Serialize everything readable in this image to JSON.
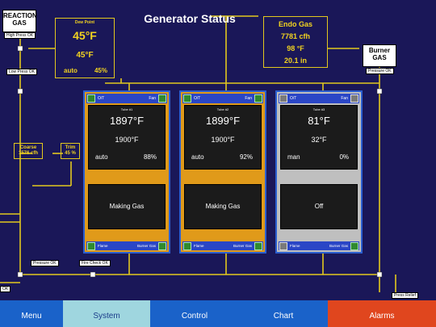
{
  "title": "Generator Status",
  "reaction_gas": {
    "label_line1": "REACTION",
    "label_line2": "GAS",
    "high_press_tag": "High Press OK",
    "low_press_tag": "Low Press OK"
  },
  "burner_gas": {
    "label_line1": "Burner",
    "label_line2": "GAS",
    "pressure_tag": "Pressure OK"
  },
  "dew_point": {
    "label": "Dew Point",
    "value": "45°F",
    "setpoint": "45°F",
    "mode": "auto",
    "output": "45%"
  },
  "endo_gas": {
    "label": "Endo Gas",
    "flow": "7781 cfh",
    "temp": "98 °F",
    "pressure": "20.1 in"
  },
  "coarse": {
    "label": "Coarse",
    "value": "1576 cfh"
  },
  "trim": {
    "label": "Trim",
    "value": "45 %"
  },
  "bottom_tags": {
    "pressure_ok": "Pressure OK",
    "fire_check_ok": "Fire Check OK",
    "press_relief": "Press Relief",
    "left_ok": "OK"
  },
  "tubes": [
    {
      "ot": "O/T",
      "fan": "Fan",
      "name": "Tube #1",
      "temp": "1897°F",
      "setpoint": "1900°F",
      "mode": "auto",
      "output": "88%",
      "status": "Making Gas",
      "flame": "Flame",
      "burner": "Burner Gas"
    },
    {
      "ot": "O/T",
      "fan": "Fan",
      "name": "Tube #2",
      "temp": "1899°F",
      "setpoint": "1900°F",
      "mode": "auto",
      "output": "92%",
      "status": "Making Gas",
      "flame": "Flame",
      "burner": "Burner Gas"
    },
    {
      "ot": "O/T",
      "fan": "Fan",
      "name": "Tube #3",
      "temp": "81°F",
      "setpoint": "32°F",
      "mode": "man",
      "output": "0%",
      "status": "Off",
      "flame": "Flame",
      "burner": "Burner Gas"
    }
  ],
  "nav": {
    "menu": "Menu",
    "system": "System",
    "control": "Control",
    "chart": "Chart",
    "alarms": "Alarms"
  },
  "colors": {
    "background": "#1a1758",
    "pipe": "#e2c81e",
    "tube_active": "#e09a1a",
    "tube_off": "#bfbfbf",
    "nav_menu": "#1a62c9",
    "nav_system": "#9fd6df",
    "nav_alarms": "#e0461e"
  }
}
